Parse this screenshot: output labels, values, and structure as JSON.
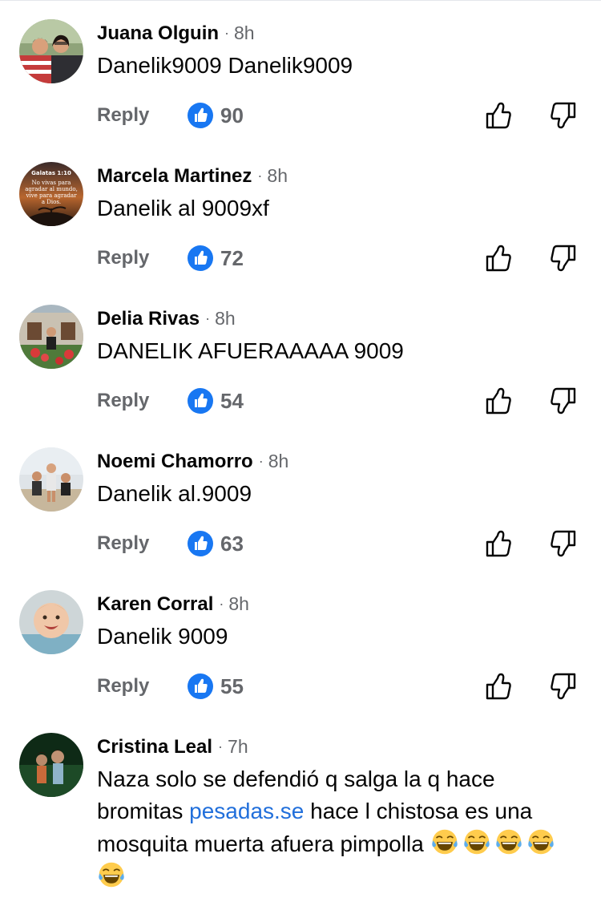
{
  "colors": {
    "link": "#216fdb",
    "like_badge": "#1877f2",
    "muted": "#65676b",
    "text": "#050505"
  },
  "icons": {
    "like_badge": "blue-thumbs-up-badge-icon",
    "upvote": "thumbs-up-outline-icon",
    "downvote": "thumbs-down-outline-icon",
    "emoji": "face-with-tears-of-joy-icon"
  },
  "comments": [
    {
      "author": "Juana Olguin",
      "time": "8h",
      "text": "Danelik9009 Danelik9009",
      "reply_label": "Reply",
      "likes": "90"
    },
    {
      "author": "Marcela Martinez",
      "time": "8h",
      "text": "Danelik al 9009xf",
      "reply_label": "Reply",
      "likes": "72",
      "avatar_text": {
        "title": "Galatas 1:10",
        "line1": "No vivas para",
        "line2": "agradar al mundo,",
        "line3": "vive para agradar",
        "line4": "a Dios."
      }
    },
    {
      "author": "Delia Rivas",
      "time": "8h",
      "text": "DANELIK AFUERAAAAA 9009",
      "reply_label": "Reply",
      "likes": "54"
    },
    {
      "author": "Noemi Chamorro",
      "time": "8h",
      "text": "Danelik al.9009",
      "reply_label": "Reply",
      "likes": "63"
    },
    {
      "author": "Karen Corral",
      "time": "8h",
      "text": "Danelik 9009",
      "reply_label": "Reply",
      "likes": "55"
    },
    {
      "author": "Cristina Leal",
      "time": "7h",
      "text_part1": "Naza solo se defendió q salga la q hace bromitas ",
      "text_link": "pesadas.se",
      "text_part2": " hace l chistosa es una mosquita muerta afuera pimpolla "
    }
  ]
}
